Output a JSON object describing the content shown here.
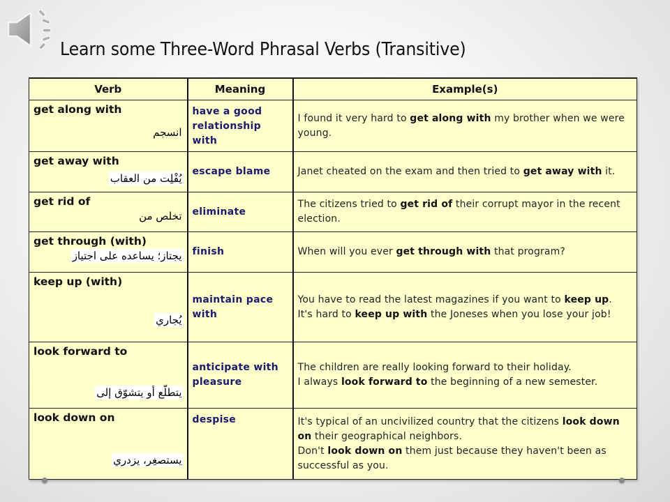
{
  "slide": {
    "title": "Learn some Three-Word Phrasal Verbs (Transitive)",
    "speaker_icon": "speaker-audio-icon",
    "colors": {
      "table_bg": "#ffffcc",
      "meaning_text": "#1a1a6e",
      "border": "#222222"
    }
  },
  "table": {
    "headers": [
      "Verb",
      "Meaning",
      "Example(s)"
    ],
    "rows": [
      {
        "verb": "get along with",
        "arabic": "انسجم",
        "meaning": "have a good relationship with",
        "example_parts": [
          {
            "t": "I found it very hard to "
          },
          {
            "t": "get along with",
            "b": true
          },
          {
            "t": " my brother when we were young."
          }
        ]
      },
      {
        "verb": "get away with",
        "arabic": "يُفْلِت من العقاب",
        "meaning": "escape blame",
        "example_parts": [
          {
            "t": "Janet cheated on the exam and then tried to "
          },
          {
            "t": "get away with",
            "b": true
          },
          {
            "t": " it."
          }
        ]
      },
      {
        "verb": "get rid of",
        "arabic": "تخلص من",
        "meaning": "eliminate",
        "example_parts": [
          {
            "t": "The citizens tried to "
          },
          {
            "t": "get rid of",
            "b": true
          },
          {
            "t": " their corrupt mayor in the recent election."
          }
        ]
      },
      {
        "verb": "get through (with)",
        "arabic": "يجتاز؛ يساعده على اجتياز",
        "meaning": "finish",
        "example_parts": [
          {
            "t": "When will you ever "
          },
          {
            "t": "get through with",
            "b": true
          },
          {
            "t": " that program?"
          }
        ]
      },
      {
        "verb": "keep up (with)",
        "arabic": "يُجاري",
        "meaning": "maintain pace with",
        "example_parts": [
          {
            "t": "You have to read the latest magazines if you want to "
          },
          {
            "t": "keep up",
            "b": true
          },
          {
            "t": ".",
            "br": true
          },
          {
            "t": "It's hard to "
          },
          {
            "t": "keep up with",
            "b": true
          },
          {
            "t": " the Joneses when you lose your job!"
          }
        ]
      },
      {
        "verb": "look forward to",
        "arabic": "يتطلّع أو يتشوّق إلى",
        "meaning": "anticipate with pleasure",
        "example_parts": [
          {
            "t": "The children are really looking forward to their holiday.",
            "br": true
          },
          {
            "t": "I always "
          },
          {
            "t": "look forward to",
            "b": true
          },
          {
            "t": " the beginning of a new semester."
          }
        ]
      },
      {
        "verb": "look down on",
        "arabic": "يستصغِر، يزدري",
        "meaning": "despise",
        "example_parts": [
          {
            "t": "It's typical of an uncivilized country that the citizens "
          },
          {
            "t": "look down on",
            "b": true
          },
          {
            "t": " their geographical neighbors.",
            "br": true
          },
          {
            "t": "Don't "
          },
          {
            "t": "look down on",
            "b": true
          },
          {
            "t": " them just because they haven't been as successful as you."
          }
        ]
      }
    ]
  }
}
